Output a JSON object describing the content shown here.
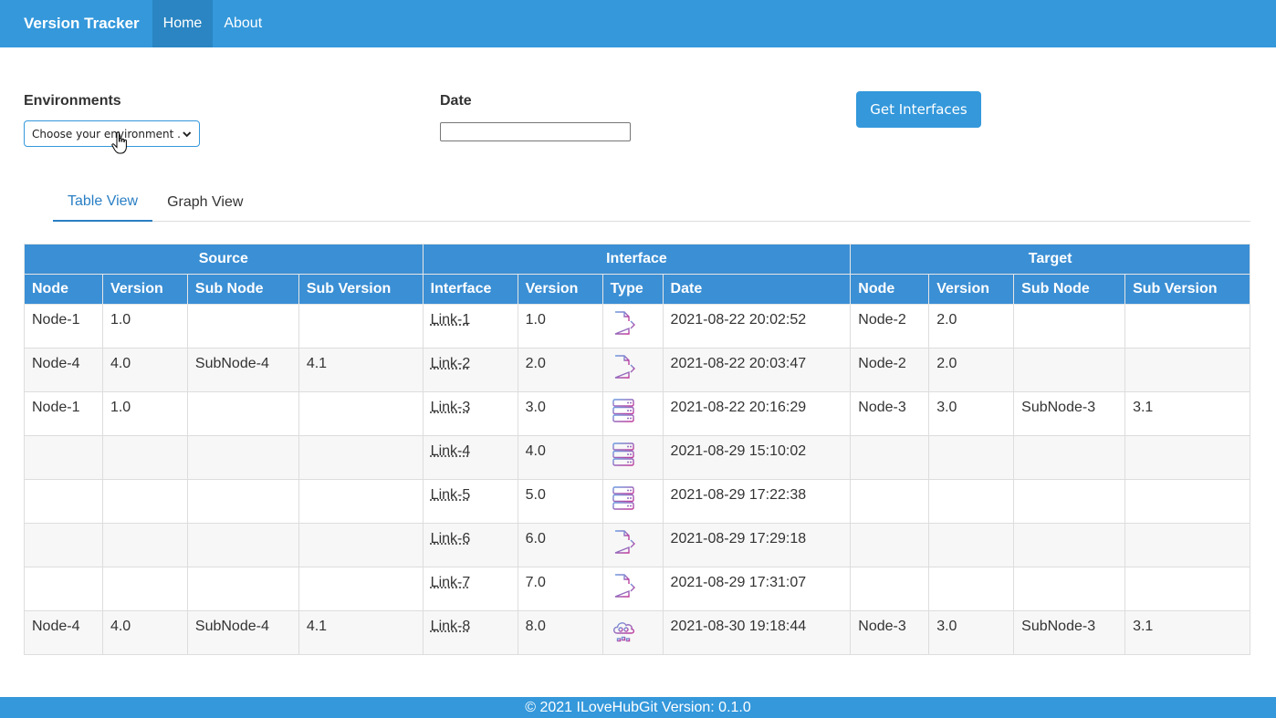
{
  "navbar": {
    "brand": "Version Tracker",
    "links": [
      "Home",
      "About"
    ]
  },
  "form": {
    "environments_label": "Environments",
    "environment_selected": "Choose your environment ...",
    "date_label": "Date",
    "date_value": "",
    "submit_label": "Get Interfaces"
  },
  "tabs": [
    "Table View",
    "Graph View"
  ],
  "table": {
    "groups": [
      "Source",
      "Interface",
      "Target"
    ],
    "columns": [
      "Node",
      "Version",
      "Sub Node",
      "Sub Version",
      "Interface",
      "Version",
      "Type",
      "Date",
      "Node",
      "Version",
      "Sub Node",
      "Sub Version"
    ],
    "rows": [
      {
        "src_node": "Node-1",
        "src_version": "1.0",
        "src_subnode": "",
        "src_subversion": "",
        "interface": "Link-1",
        "version": "1.0",
        "type": "file-export-icon",
        "date": "2021-08-22 20:02:52",
        "tgt_node": "Node-2",
        "tgt_version": "2.0",
        "tgt_subnode": "",
        "tgt_subversion": ""
      },
      {
        "src_node": "Node-4",
        "src_version": "4.0",
        "src_subnode": "SubNode-4",
        "src_subversion": "4.1",
        "interface": "Link-2",
        "version": "2.0",
        "type": "file-export-icon",
        "date": "2021-08-22 20:03:47",
        "tgt_node": "Node-2",
        "tgt_version": "2.0",
        "tgt_subnode": "",
        "tgt_subversion": ""
      },
      {
        "src_node": "Node-1",
        "src_version": "1.0",
        "src_subnode": "",
        "src_subversion": "",
        "interface": "Link-3",
        "version": "3.0",
        "type": "database-icon",
        "date": "2021-08-22 20:16:29",
        "tgt_node": "Node-3",
        "tgt_version": "3.0",
        "tgt_subnode": "SubNode-3",
        "tgt_subversion": "3.1"
      },
      {
        "src_node": "",
        "src_version": "",
        "src_subnode": "",
        "src_subversion": "",
        "interface": "Link-4",
        "version": "4.0",
        "type": "database-icon",
        "date": "2021-08-29 15:10:02",
        "tgt_node": "",
        "tgt_version": "",
        "tgt_subnode": "",
        "tgt_subversion": ""
      },
      {
        "src_node": "",
        "src_version": "",
        "src_subnode": "",
        "src_subversion": "",
        "interface": "Link-5",
        "version": "5.0",
        "type": "database-icon",
        "date": "2021-08-29 17:22:38",
        "tgt_node": "",
        "tgt_version": "",
        "tgt_subnode": "",
        "tgt_subversion": ""
      },
      {
        "src_node": "",
        "src_version": "",
        "src_subnode": "",
        "src_subversion": "",
        "interface": "Link-6",
        "version": "6.0",
        "type": "file-export-icon",
        "date": "2021-08-29 17:29:18",
        "tgt_node": "",
        "tgt_version": "",
        "tgt_subnode": "",
        "tgt_subversion": ""
      },
      {
        "src_node": "",
        "src_version": "",
        "src_subnode": "",
        "src_subversion": "",
        "interface": "Link-7",
        "version": "7.0",
        "type": "file-export-icon",
        "date": "2021-08-29 17:31:07",
        "tgt_node": "",
        "tgt_version": "",
        "tgt_subnode": "",
        "tgt_subversion": ""
      },
      {
        "src_node": "Node-4",
        "src_version": "4.0",
        "src_subnode": "SubNode-4",
        "src_subversion": "4.1",
        "interface": "Link-8",
        "version": "8.0",
        "type": "cloud-network-icon",
        "date": "2021-08-30 19:18:44",
        "tgt_node": "Node-3",
        "tgt_version": "3.0",
        "tgt_subnode": "SubNode-3",
        "tgt_subversion": "3.1"
      }
    ]
  },
  "footer": {
    "text": "© 2021 ILoveHubGit Version: 0.1.0"
  },
  "colors": {
    "primary": "#3498db",
    "header_cell": "#3b8fd4",
    "active_tab": "#2a7fc4",
    "icon_gradient_start": "#6a9be0",
    "icon_gradient_end": "#c2389a"
  }
}
